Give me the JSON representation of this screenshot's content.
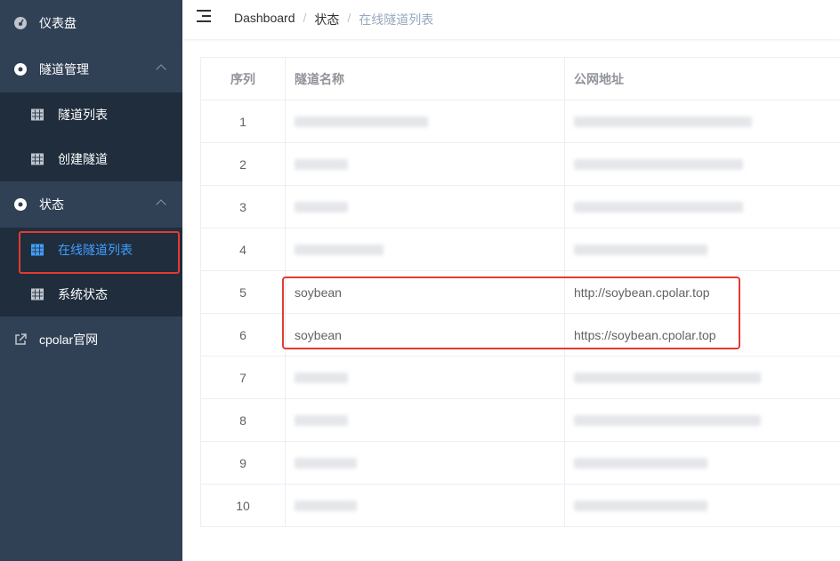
{
  "sidebar": {
    "dashboard_label": "仪表盘",
    "tunnel_mgmt_label": "隧道管理",
    "tunnel_list_label": "隧道列表",
    "create_tunnel_label": "创建隧道",
    "status_label": "状态",
    "online_tunnels_label": "在线隧道列表",
    "system_status_label": "系统状态",
    "website_label": "cpolar官网"
  },
  "breadcrumb": {
    "home": "Dashboard",
    "sep": "/",
    "section": "状态",
    "current": "在线隧道列表"
  },
  "table": {
    "headers": {
      "index": "序列",
      "name": "隧道名称",
      "url": "公网地址"
    },
    "rows": [
      {
        "index": "1",
        "name": "",
        "url": ""
      },
      {
        "index": "2",
        "name": "",
        "url": ""
      },
      {
        "index": "3",
        "name": "",
        "url": ""
      },
      {
        "index": "4",
        "name": "",
        "url": ""
      },
      {
        "index": "5",
        "name": "soybean",
        "url": "http://soybean.cpolar.top"
      },
      {
        "index": "6",
        "name": "soybean",
        "url": "https://soybean.cpolar.top"
      },
      {
        "index": "7",
        "name": "",
        "url": ""
      },
      {
        "index": "8",
        "name": "",
        "url": ""
      },
      {
        "index": "9",
        "name": "",
        "url": ""
      },
      {
        "index": "10",
        "name": "",
        "url": ""
      }
    ]
  },
  "colors": {
    "sidebar_bg": "#304156",
    "submenu_bg": "#1f2d3d",
    "accent": "#409eff",
    "annotation": "#e43a32"
  }
}
